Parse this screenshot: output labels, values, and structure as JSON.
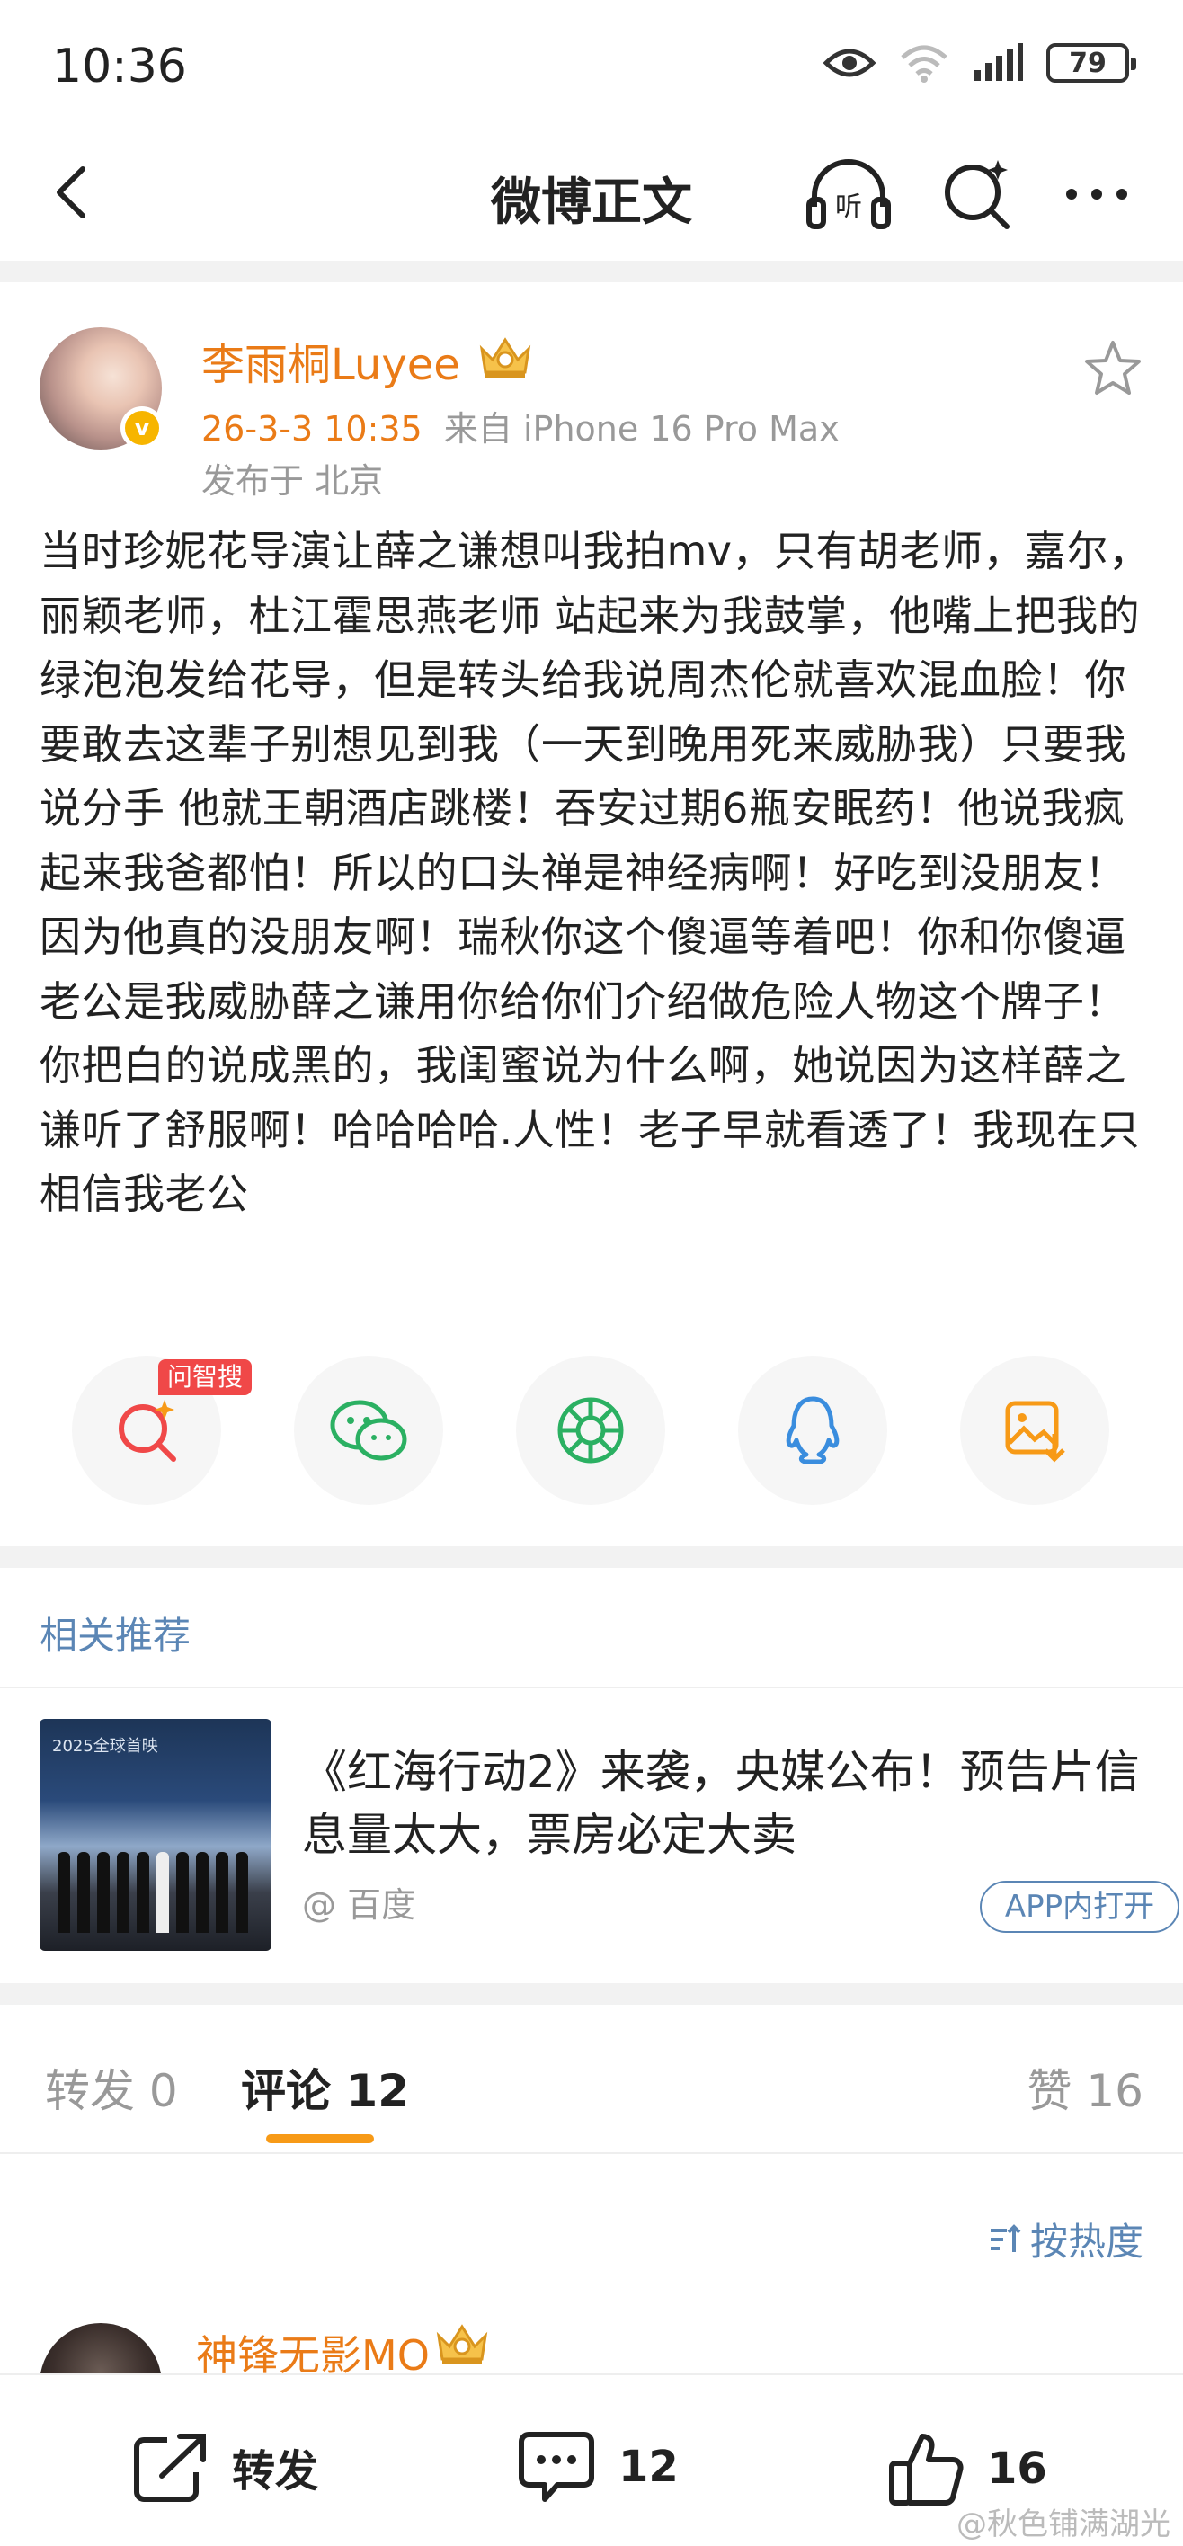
{
  "status_bar": {
    "time": "10:36",
    "battery": "79"
  },
  "nav": {
    "title": "微博正文",
    "listen_label": "听"
  },
  "post": {
    "user_name": "李雨桐Luyee",
    "verified_badge": "v",
    "date": "26-3-3 10:35",
    "source": "来自 iPhone 16 Pro Max",
    "location": "发布于 北京",
    "content": "当时珍妮花导演让薛之谦想叫我拍mv，只有胡老师，嘉尔，丽颖老师，杜江霍思燕老师 站起来为我鼓掌，他嘴上把我的绿泡泡发给花导，但是转头给我说周杰伦就喜欢混血脸！你要敢去这辈子别想见到我（一天到晚用死来威胁我）只要我说分手 他就王朝酒店跳楼！吞安过期6瓶安眠药！他说我疯起来我爸都怕！所以的口头禅是神经病啊！好吃到没朋友！因为他真的没朋友啊！瑞秋你这个傻逼等着吧！你和你傻逼老公是我威胁薛之谦用你给你们介绍做危险人物这个牌子！你把白的说成黑的，我闺蜜说为什么啊，她说因为这样薛之谦听了舒服啊！哈哈哈哈.人性！老子早就看透了！我现在只相信我老公"
  },
  "share": {
    "tag": "问智搜"
  },
  "related": {
    "section_title": "相关推荐",
    "thumb_text": "2025全球首映",
    "title": "《红海行动2》来袭，央媒公布！预告片信息量太大，票房必定大卖",
    "source": "@ 百度",
    "open_button": "APP内打开"
  },
  "tabs": {
    "repost": "转发 0",
    "comment": "评论 12",
    "like": "赞 16"
  },
  "sort_label": "按热度",
  "comment": {
    "user_name": "神锋无影MO"
  },
  "bottom": {
    "repost": "转发",
    "comment_count": "12",
    "like_count": "16"
  },
  "watermark": "@秋色铺满湖光",
  "colors": {
    "accent_orange": "#ea7b17",
    "link_blue": "#5b86b5",
    "indicator": "#f79a17"
  }
}
